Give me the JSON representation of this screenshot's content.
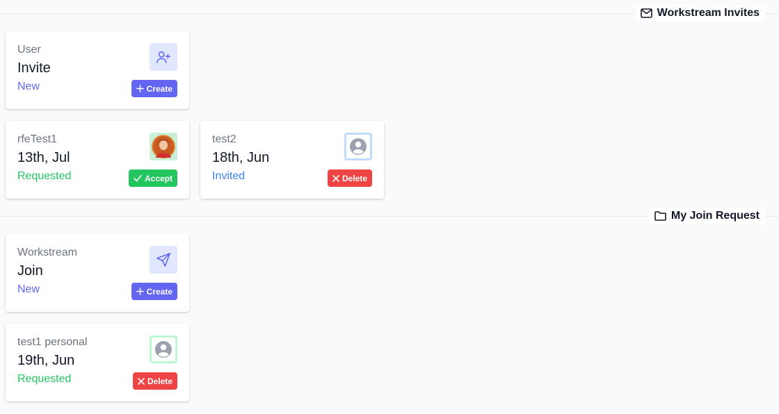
{
  "sections": {
    "invites": {
      "title": "Workstream Invites",
      "icon": "mail-icon"
    },
    "join": {
      "title": "My Join Request",
      "icon": "folder-icon"
    }
  },
  "invite_new_card": {
    "subtitle": "User",
    "title": "Invite",
    "status": "New",
    "button": "Create",
    "icon": "user-plus-icon"
  },
  "invite_cards": [
    {
      "name": "rfeTest1",
      "date": "13th, Jul",
      "status": "Requested",
      "button": "Accept",
      "avatar": "user-photo-avatar"
    },
    {
      "name": "test2",
      "date": "18th, Jun",
      "status": "Invited",
      "button": "Delete",
      "avatar": "default-avatar"
    }
  ],
  "join_new_card": {
    "subtitle": "Workstream",
    "title": "Join",
    "status": "New",
    "button": "Create",
    "icon": "send-icon"
  },
  "join_cards": [
    {
      "name": "test1 personal",
      "date": "19th, Jun",
      "status": "Requested",
      "button": "Delete",
      "avatar": "default-avatar"
    }
  ],
  "colors": {
    "accent": "#6366f1",
    "success": "#22c55e",
    "danger": "#ef4444",
    "info": "#3b82f6"
  }
}
